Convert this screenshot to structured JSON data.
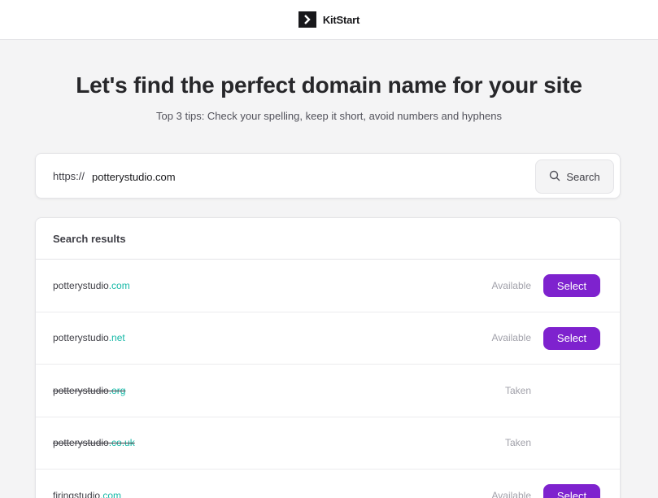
{
  "header": {
    "brand": "KitStart"
  },
  "hero": {
    "title": "Let's find the perfect domain name for your site",
    "subtitle": "Top 3 tips: Check your spelling, keep it short, avoid numbers and hyphens"
  },
  "search": {
    "prefix": "https://",
    "value": "potterystudio.com",
    "button_label": "Search"
  },
  "results": {
    "title": "Search results",
    "select_label": "Select",
    "rows": [
      {
        "name": "potterystudio",
        "tld": ".com",
        "status": "Available"
      },
      {
        "name": "potterystudio",
        "tld": ".net",
        "status": "Available"
      },
      {
        "name": "potterystudio",
        "tld": ".org",
        "status": "Taken"
      },
      {
        "name": "potterystudio",
        "tld": ".co.uk",
        "status": "Taken"
      },
      {
        "name": "firingstudio",
        "tld": ".com",
        "status": "Available"
      }
    ]
  },
  "colors": {
    "accent": "#7e22ce",
    "tld": "#14b8a6"
  }
}
